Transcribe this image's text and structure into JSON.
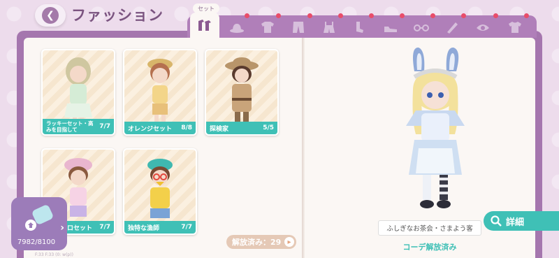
{
  "header": {
    "title": "ファッション"
  },
  "tabs": {
    "active_label": "セット",
    "items": [
      {
        "name": "set-tab",
        "icon": "outfit-set-icon"
      },
      {
        "name": "hat-tab",
        "icon": "hat-icon"
      },
      {
        "name": "top-tab",
        "icon": "shirt-icon"
      },
      {
        "name": "bottom-tab",
        "icon": "pants-icon"
      },
      {
        "name": "overall-tab",
        "icon": "overall-icon"
      },
      {
        "name": "socks-tab",
        "icon": "socks-icon"
      },
      {
        "name": "shoes-tab",
        "icon": "shoes-icon"
      },
      {
        "name": "glasses-tab",
        "icon": "glasses-icon"
      },
      {
        "name": "accessory-tab",
        "icon": "accessory-icon"
      },
      {
        "name": "face-tab",
        "icon": "face-icon"
      },
      {
        "name": "tshirt-tab",
        "icon": "tshirt-icon"
      }
    ]
  },
  "cards": [
    {
      "name": "ラッキーセット・高みを目指して",
      "count": "7/7"
    },
    {
      "name": "オレンジセット",
      "count": "8/8"
    },
    {
      "name": "探検家",
      "count": "5/5"
    },
    {
      "name": "ロセット",
      "count": "7/7"
    },
    {
      "name": "独特な漁師",
      "count": "7/7"
    }
  ],
  "unlocked": {
    "label": "解放済み：29"
  },
  "collection": {
    "count": "7982/8100"
  },
  "preview": {
    "detail_label": "詳細",
    "outfit_name": "ふしぎなお茶会・さまよう客",
    "status": "コーデ解放済み"
  },
  "footer": {
    "text": "F:33  F:33  (0: w(p))"
  },
  "colors": {
    "accent_teal": "#3fc0b6",
    "book_purple": "#a576ae",
    "badge_red": "#e84d6a"
  }
}
